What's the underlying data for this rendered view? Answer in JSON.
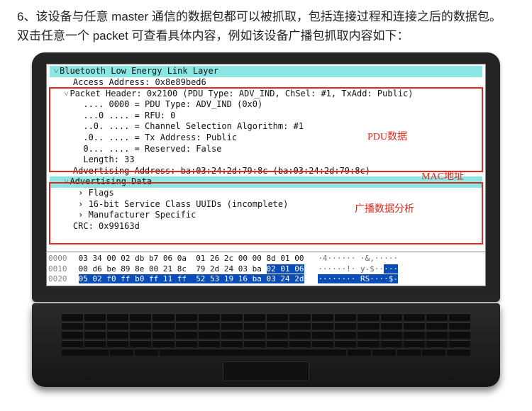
{
  "caption_line1": "6、该设备与任意 master 通信的数据包都可以被抓取，包括连接过程和连接之后的数据包。",
  "caption_line2": "双击任意一个 packet 可查看具体内容，例如该设备广播包抓取内容如下：",
  "tree": {
    "root": "Bluetooth Low Energy Link Layer",
    "access_address": "Access Address: 0x8e89bed6",
    "pkt_header": "Packet Header: 0x2100 (PDU Type: ADV_IND, ChSel: #1, TxAdd: Public)",
    "pdu_type": ".... 0000 = PDU Type: ADV_IND (0x0)",
    "rfu": "...0 .... = RFU: 0",
    "chsel": "..0. .... = Channel Selection Algorithm: #1",
    "txaddr": ".0.. .... = Tx Address: Public",
    "reserved": "0... .... = Reserved: False",
    "length": "Length: 33",
    "adv_addr": "Advertising Address: ba:03:24:2d:79:8c (ba:03:24:2d:79:8c)",
    "adv_data": "Advertising Data",
    "flags": "Flags",
    "uuids": "16-bit Service Class UUIDs (incomplete)",
    "manuf": "Manufacturer Specific",
    "crc": "CRC: 0x99163d"
  },
  "annotations": {
    "pdu": "PDU数据",
    "mac": "MAC地址",
    "bcast": "广播数据分析"
  },
  "hex": {
    "r0_off": "0000",
    "r0_b": "03 34 00 02 db b7 06 0a  01 26 2c 00 00 8d 01 00",
    "r0_a": "·4······ ·&,·····",
    "r1_off": "0010",
    "r1_b1": "00 d6 be 89 8e 00 21 8c  79 2d 24 03 ba ",
    "r1_b2": "02 01 06",
    "r1_a1": "······!· y-$··",
    "r1_a2": "···",
    "r2_off": "0020",
    "r2_b": "05 02 f0 ff b0 ff 11 ff  52 53 19 16 ba 03 24 2d",
    "r2_a": "········ RS····$-"
  }
}
